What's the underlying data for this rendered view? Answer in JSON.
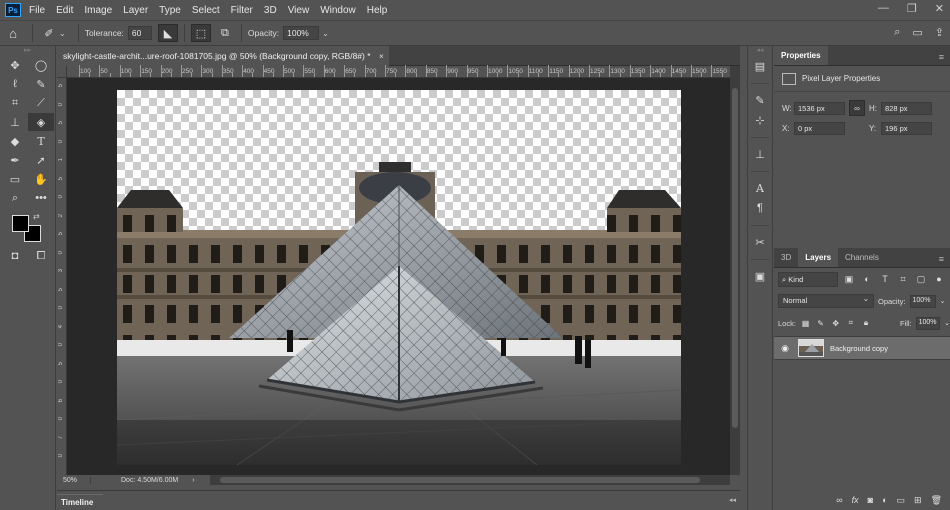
{
  "menubar": {
    "app_logo": "Ps",
    "items": [
      "File",
      "Edit",
      "Image",
      "Layer",
      "Type",
      "Select",
      "Filter",
      "3D",
      "View",
      "Window",
      "Help"
    ]
  },
  "options": {
    "tolerance_label": "Tolerance:",
    "tolerance_value": "60",
    "opacity_label": "Opacity:",
    "opacity_value": "100%"
  },
  "document": {
    "tab_title": "skylight-castle-archit...ure-roof-1081705.jpg @ 50% (Background copy, RGB/8#) *",
    "tab_close": "×",
    "ruler_h_labels": [
      "100",
      "50",
      "100",
      "150",
      "200",
      "250",
      "300",
      "350",
      "400",
      "450",
      "500",
      "550",
      "600",
      "650",
      "700",
      "750",
      "800",
      "850",
      "900",
      "950",
      "1000",
      "1050",
      "1100",
      "1150",
      "1200",
      "1250",
      "1300",
      "1350",
      "1400",
      "1450",
      "1500",
      "1550",
      "1600"
    ],
    "ruler_v_labels": [
      "5",
      "0",
      "5",
      "0",
      "1",
      "5",
      "0",
      "2",
      "5",
      "0",
      "3",
      "5",
      "0",
      "4",
      "0",
      "5",
      "0",
      "6",
      "0",
      "7",
      "0"
    ],
    "zoom": "50%",
    "doc_size": "Doc: 4.50M/6.00M"
  },
  "timeline": {
    "label": "Timeline"
  },
  "properties": {
    "tab_label": "Properties",
    "subtitle": "Pixel Layer Properties",
    "w_label": "W:",
    "w_value": "1536 px",
    "h_label": "H:",
    "h_value": "828 px",
    "x_label": "X:",
    "x_value": "0 px",
    "y_label": "Y:",
    "y_value": "196 px"
  },
  "layers": {
    "tabs": [
      "3D",
      "Layers",
      "Channels"
    ],
    "kind_label": "Kind",
    "blend_mode": "Normal",
    "opacity_label": "Opacity:",
    "opacity_value": "100%",
    "lock_label": "Lock:",
    "fill_label": "Fill:",
    "fill_value": "100%",
    "items": [
      {
        "name": "Background copy",
        "visible": true
      }
    ]
  },
  "colors": {
    "accent": "#31a8ff",
    "panel_bg": "#535353",
    "canvas_bg": "#282828",
    "selected_layer": "#6c6c6c"
  }
}
